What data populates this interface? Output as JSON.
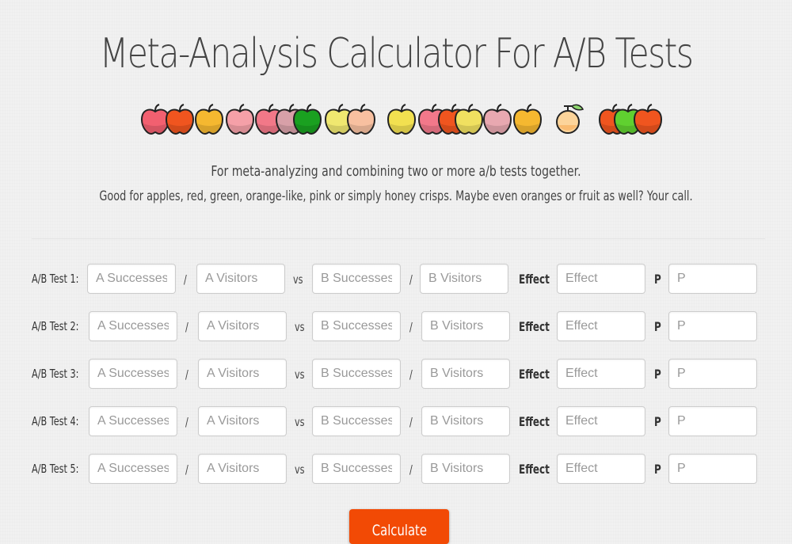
{
  "header": {
    "title": "Meta-Analysis Calculator For A/B Tests",
    "subtitle": "For meta-analyzing and combining two or more a/b tests together.",
    "tagline": "Good for apples, red, green, orange-like, pink or simply honey crisps. Maybe even oranges or fruit as well? Your call."
  },
  "decoration": {
    "icons": [
      {
        "name": "apple-icon",
        "color": "#f26070"
      },
      {
        "name": "apple-icon",
        "color": "#f0551f"
      },
      {
        "name": "apple-icon",
        "color": "#f5b830"
      },
      {
        "name": "apple-icon",
        "color": "#f5a0a8"
      },
      {
        "name": "apple-icon",
        "color": "#f27888"
      },
      {
        "name": "apple-icon",
        "color": "#d8a0a8"
      },
      {
        "name": "apple-icon",
        "color": "#1aa020"
      },
      {
        "name": "apple-icon",
        "color": "#f0e870"
      },
      {
        "name": "apple-icon",
        "color": "#f8c0a0"
      },
      {
        "name": "apple-icon",
        "color": "#f2e050"
      },
      {
        "name": "apple-icon",
        "color": "#f2788a"
      },
      {
        "name": "apple-icon",
        "color": "#f0551f"
      },
      {
        "name": "apple-icon",
        "color": "#f0e060"
      },
      {
        "name": "apple-icon",
        "color": "#e8a8b0"
      },
      {
        "name": "apple-icon",
        "color": "#f5b830"
      },
      {
        "name": "orange-icon",
        "color": "#fcd49a"
      },
      {
        "name": "apple-icon",
        "color": "#f0551f"
      },
      {
        "name": "apple-icon",
        "color": "#60d030"
      },
      {
        "name": "apple-icon",
        "color": "#f0551f"
      }
    ]
  },
  "form": {
    "vs_label": "vs",
    "slash_label": "/",
    "effect_label": "Effect",
    "p_label": "P",
    "placeholders": {
      "a_successes": "A Successes",
      "a_visitors": "A Visitors",
      "b_successes": "B Successes",
      "b_visitors": "B Visitors",
      "effect": "Effect",
      "p": "P"
    },
    "rows": [
      {
        "label": "A/B Test 1:",
        "a_successes": "",
        "a_visitors": "",
        "b_successes": "",
        "b_visitors": "",
        "effect": "",
        "p": ""
      },
      {
        "label": "A/B Test 2:",
        "a_successes": "",
        "a_visitors": "",
        "b_successes": "",
        "b_visitors": "",
        "effect": "",
        "p": ""
      },
      {
        "label": "A/B Test 3:",
        "a_successes": "",
        "a_visitors": "",
        "b_successes": "",
        "b_visitors": "",
        "effect": "",
        "p": ""
      },
      {
        "label": "A/B Test 4:",
        "a_successes": "",
        "a_visitors": "",
        "b_successes": "",
        "b_visitors": "",
        "effect": "",
        "p": ""
      },
      {
        "label": "A/B Test 5:",
        "a_successes": "",
        "a_visitors": "",
        "b_successes": "",
        "b_visitors": "",
        "effect": "",
        "p": ""
      }
    ],
    "calculate_label": "Calculate"
  },
  "colors": {
    "accent": "#f24a05",
    "text": "#444444"
  }
}
